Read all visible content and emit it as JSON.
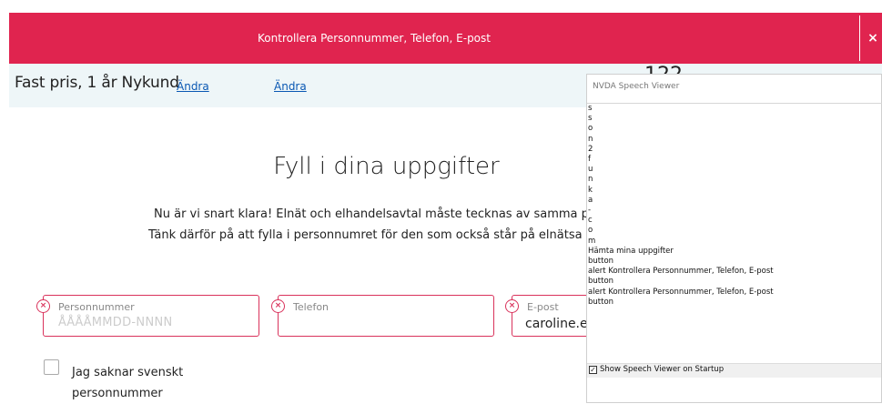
{
  "alert": {
    "message": "Kontrollera Personnummer, Telefon, E-post",
    "close_symbol": "×",
    "color": "#e0244f"
  },
  "subheader": {
    "plan_text": "Fast pris, 1 år Nykund",
    "change_link_1": "Ändra",
    "change_link_2": "Ändra",
    "price_partial": "122",
    "background": "#eef6f8"
  },
  "main": {
    "heading": "Fyll i dina uppgifter",
    "paragraph_line_1": "Nu är vi snart klara! Elnät och elhandelsavtal måste tecknas av samma pe",
    "paragraph_line_2": "Tänk därför på att fylla i personnumret för den som också står på elnätsa"
  },
  "form": {
    "personnummer": {
      "label": "Personnummer",
      "placeholder": "ÅÅÅÅMMDD-NNNN",
      "value": ""
    },
    "telefon": {
      "label": "Telefon",
      "value": ""
    },
    "epost": {
      "label": "E-post",
      "value": "caroline.e"
    },
    "error_icon": "×",
    "no_personnummer_label_line1": "Jag saknar svenskt",
    "no_personnummer_label_line2": "personnummer",
    "no_personnummer_checked": false
  },
  "nvda": {
    "title": "NVDA Speech Viewer",
    "lines": [
      "s",
      "s",
      "o",
      "n",
      "2",
      "f",
      "u",
      "n",
      "k",
      "a",
      "-",
      "c",
      "o",
      "m",
      "Hämta mina uppgifter",
      "button",
      "alert  Kontrollera Personnummer, Telefon, E-post",
      "button",
      "alert  Kontrollera Personnummer, Telefon, E-post",
      "button"
    ],
    "footer_checkbox_label": "Show Speech Viewer on Startup",
    "footer_checked": true,
    "check_symbol": "✓"
  }
}
